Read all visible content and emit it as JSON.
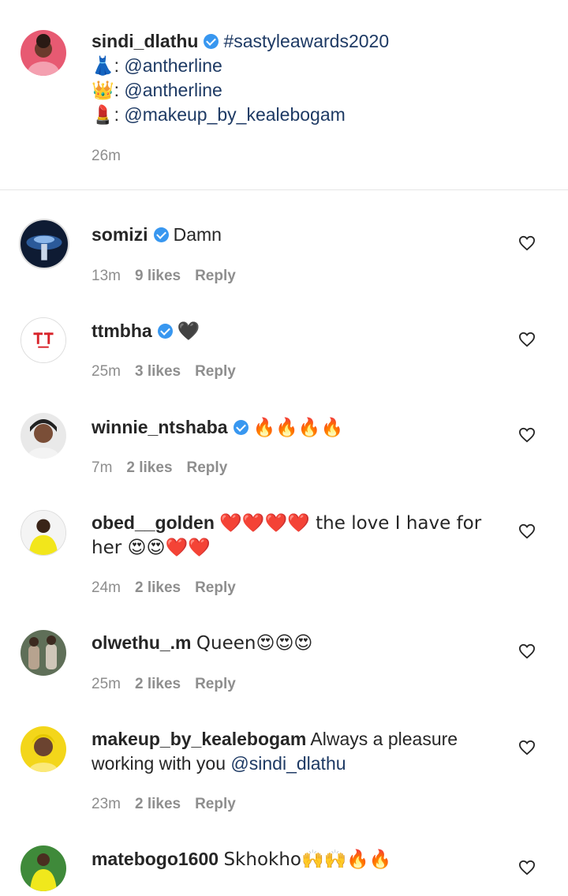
{
  "caption": {
    "username": "sindi_dlathu",
    "hashtag": "#sastyleawards2020",
    "credits": [
      {
        "icon": "dress-emoji",
        "glyph": "👗",
        "handle": "@antherline"
      },
      {
        "icon": "crown-emoji",
        "glyph": "👑",
        "handle": "@antherline"
      },
      {
        "icon": "lipstick-emoji",
        "glyph": "💄",
        "handle": "@makeup_by_kealebogam"
      }
    ],
    "time": "26m"
  },
  "comments": [
    {
      "username": "somizi",
      "verified": true,
      "text": "Damn",
      "time": "13m",
      "likes": "9 likes",
      "reply": "Reply"
    },
    {
      "username": "ttmbha",
      "verified": true,
      "text": "🖤",
      "time": "25m",
      "likes": "3 likes",
      "reply": "Reply"
    },
    {
      "username": "winnie_ntshaba",
      "verified": true,
      "text": "🔥🔥🔥🔥",
      "time": "7m",
      "likes": "2 likes",
      "reply": "Reply"
    },
    {
      "username": "obed__golden",
      "verified": false,
      "text": "❤️❤️❤️❤️ the love I have for",
      "text2": "her 😍😍❤️❤️",
      "time": "24m",
      "likes": "2 likes",
      "reply": "Reply"
    },
    {
      "username": "olwethu_.m",
      "verified": false,
      "text": "Queen😍😍😍",
      "time": "25m",
      "likes": "2 likes",
      "reply": "Reply"
    },
    {
      "username": "makeup_by_kealebogam",
      "verified": false,
      "text": "Always a pleasure",
      "text2": "working with you ",
      "mention": "@sindi_dlathu",
      "time": "23m",
      "likes": "2 likes",
      "reply": "Reply"
    },
    {
      "username": "matebogo1600",
      "verified": false,
      "text": "Skhokho🙌🙌🔥🔥"
    }
  ],
  "colors": {
    "link": "#1e3a64",
    "verified": "#3897f0",
    "meta": "#8e8e8e"
  }
}
